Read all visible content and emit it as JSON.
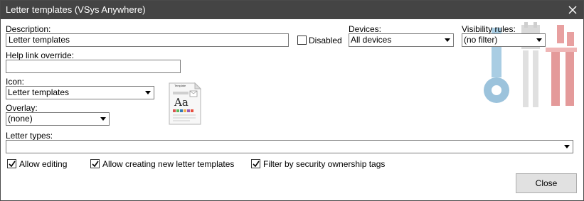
{
  "window": {
    "title": "Letter templates (VSys Anywhere)"
  },
  "description": {
    "label": "Description:",
    "value": "Letter templates"
  },
  "disabled": {
    "label": "Disabled",
    "checked": false
  },
  "devices": {
    "label": "Devices:",
    "value": "All devices"
  },
  "visibility_rules": {
    "label": "Visibility rules:",
    "value": "(no filter)"
  },
  "help_link": {
    "label": "Help link override:",
    "value": ""
  },
  "icon": {
    "label": "Icon:",
    "value": "Letter templates"
  },
  "overlay": {
    "label": "Overlay:",
    "value": "(none)"
  },
  "letter_types": {
    "label": "Letter types:",
    "value": ""
  },
  "options": {
    "allow_editing": {
      "label": "Allow editing",
      "checked": true
    },
    "allow_creating": {
      "label": "Allow creating new letter templates",
      "checked": true
    },
    "filter_security": {
      "label": "Filter by security ownership tags",
      "checked": true
    }
  },
  "buttons": {
    "close": "Close"
  },
  "preview": {
    "heading": "Template",
    "glyph": "Aa",
    "icon": "letter-template-icon"
  },
  "watermark": {
    "icon": "tools-icon"
  },
  "colors": {
    "titlebar": "#444444",
    "watermark_blue": "#9cc3dc",
    "watermark_red": "#e8a0a0",
    "watermark_gray": "#cfcfcf"
  }
}
